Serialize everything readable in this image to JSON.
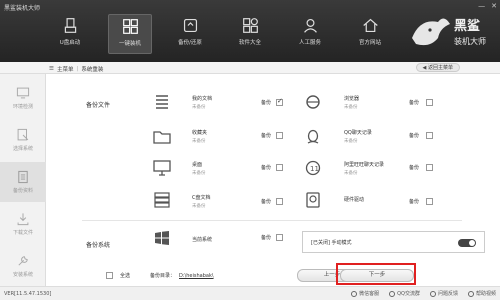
{
  "app": {
    "title": "黑鲨装机大师",
    "min": "—",
    "close": "✕"
  },
  "nav": [
    {
      "label": "U盘启动",
      "icon": "usb-icon",
      "active": false
    },
    {
      "label": "一键装机",
      "icon": "grid-icon",
      "active": true
    },
    {
      "label": "备份/还原",
      "icon": "backup-icon",
      "active": false
    },
    {
      "label": "软件大全",
      "icon": "apps-icon",
      "active": false
    },
    {
      "label": "人工服务",
      "icon": "support-icon",
      "active": false
    },
    {
      "label": "官方网站",
      "icon": "home-icon",
      "active": false
    }
  ],
  "logo": {
    "text1": "黑鲨",
    "text2": "装机大师"
  },
  "breadcrumb": {
    "home": "主菜单",
    "sep": "|",
    "current": "系统重装",
    "back": "返回主菜单"
  },
  "sidebar": [
    {
      "label": "环境检测",
      "icon": "monitor-icon"
    },
    {
      "label": "选择系统",
      "icon": "select-system-icon"
    },
    {
      "label": "备份资料",
      "icon": "backup-data-icon"
    },
    {
      "label": "下载文件",
      "icon": "download-icon"
    },
    {
      "label": "安装系统",
      "icon": "wrench-icon"
    }
  ],
  "sections": {
    "files": "备份文件",
    "system": "备份系统"
  },
  "items": {
    "docs": {
      "name": "我的文档",
      "sub": "未备份",
      "backup": "备份"
    },
    "favorites": {
      "name": "收藏夹",
      "sub": "未备份",
      "backup": "备份"
    },
    "desktop": {
      "name": "桌面",
      "sub": "未备份",
      "backup": "备份"
    },
    "cdocs": {
      "name": "C盘文档",
      "sub": "未备份",
      "backup": "备份"
    },
    "current_system": {
      "name": "当前系统",
      "backup": "备份"
    },
    "browser": {
      "name": "浏览器",
      "sub": "未备份",
      "backup": "备份"
    },
    "qq": {
      "name": "QQ聊天记录",
      "sub": "未备份",
      "backup": "备份"
    },
    "aliwangwang": {
      "name": "阿里旺旺聊天记录",
      "sub": "未备份",
      "backup": "备份"
    },
    "driver": {
      "name": "硬件驱动",
      "backup": "备份"
    }
  },
  "mode": {
    "label": "[已关闭] 手动模式"
  },
  "bottom": {
    "select_all": "全选",
    "dir_label": "备份目录：",
    "dir_value": "D:\\heishabak\\",
    "prev": "上一步",
    "next": "下一步"
  },
  "status": {
    "version": "VER[11.5.47.1530]",
    "links": [
      "微信客服",
      "QQ交流群",
      "问题反馈",
      "帮助视频"
    ]
  }
}
